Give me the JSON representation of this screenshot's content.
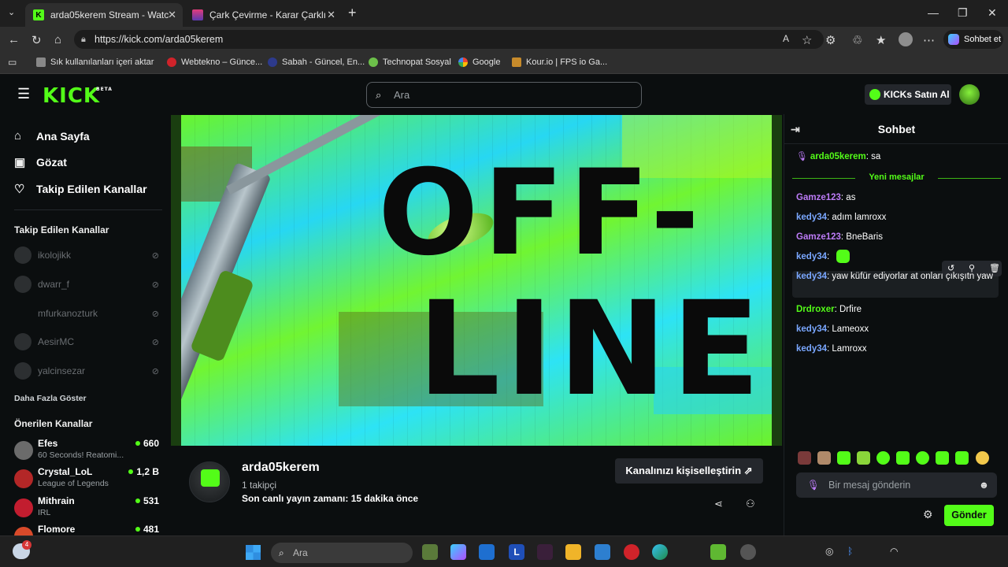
{
  "browser": {
    "tabs": [
      {
        "title": "arda05kerem Stream - Watch Live",
        "close": "✕"
      },
      {
        "title": "Çark Çevirme - Karar Çarklı",
        "close": "✕"
      }
    ],
    "new_tab": "+",
    "url": "https://kick.com/arda05kerem",
    "profile_button": "Sohbet et",
    "bookmarks": [
      "Sık kullanılanları içeri aktar",
      "Webtekno – Günce...",
      "Sabah - Güncel, En...",
      "Technopat Sosyal",
      "Google",
      "Kour.io | FPS io Ga..."
    ]
  },
  "kick": {
    "logo": "KICK",
    "logo_badge": "BETA",
    "search_placeholder": "Ara",
    "buy_kicks": "KICKs Satın Al",
    "nav": [
      {
        "label": "Ana Sayfa",
        "icon": "home-icon"
      },
      {
        "label": "Gözat",
        "icon": "browse-icon"
      },
      {
        "label": "Takip Edilen Kanallar",
        "icon": "heart-icon"
      }
    ],
    "followed_title": "Takip Edilen Kanallar",
    "followed": [
      "ikolojikk",
      "dwarr_f",
      "mfurkanozturk",
      "AesirMC",
      "yalcinsezar"
    ],
    "show_more": "Daha Fazla Göster",
    "recommended_title": "Önerilen Kanallar",
    "recommended": [
      {
        "name": "Efes",
        "category": "60 Seconds! Reatomi...",
        "viewers": "660",
        "color": "#6b6b6b"
      },
      {
        "name": "Crystal_LoL",
        "category": "League of Legends",
        "viewers": "1,2 B",
        "color": "#b32727"
      },
      {
        "name": "Mithrain",
        "category": "IRL",
        "viewers": "531",
        "color": "#c21d2f"
      },
      {
        "name": "Flomore",
        "category": "",
        "viewers": "481",
        "color": "#d84a2a"
      }
    ],
    "offline_text_1": "OFF-",
    "offline_text_2": "LINE",
    "channel": {
      "name": "arda05kerem",
      "followers": "1 takipçi",
      "last_live": "Son canlı yayın zamanı: 15 dakika önce",
      "customize": "Kanalınızı kişiselleştirin"
    }
  },
  "chat": {
    "title": "Sohbet",
    "new_messages": "Yeni mesajlar",
    "messages": [
      {
        "user": "arda05kerem",
        "text": ": sa",
        "cls": "u3"
      },
      {
        "user": "Gamze123",
        "text": ": as",
        "cls": "u1"
      },
      {
        "user": "kedy34",
        "text": ": adım lamroxx",
        "cls": "u2"
      },
      {
        "user": "Gamze123",
        "text": ": BneBaris",
        "cls": "u1"
      },
      {
        "user": "kedy34",
        "text": ":",
        "cls": "u2"
      },
      {
        "user": "kedy34",
        "text": ": yaw küfür ediyorlar at onları çıkışıtn yaw",
        "cls": "u2"
      },
      {
        "user": "Drdroxer",
        "text": ": Drfire",
        "cls": "u3"
      },
      {
        "user": "kedy34",
        "text": ": Lameoxx",
        "cls": "u2"
      },
      {
        "user": "kedy34",
        "text": ": Lamroxx",
        "cls": "u2"
      }
    ],
    "input_placeholder": "Bir mesaj gönderin",
    "send": "Gönder"
  },
  "taskbar": {
    "search_placeholder": "Ara",
    "notification_count": "4"
  }
}
